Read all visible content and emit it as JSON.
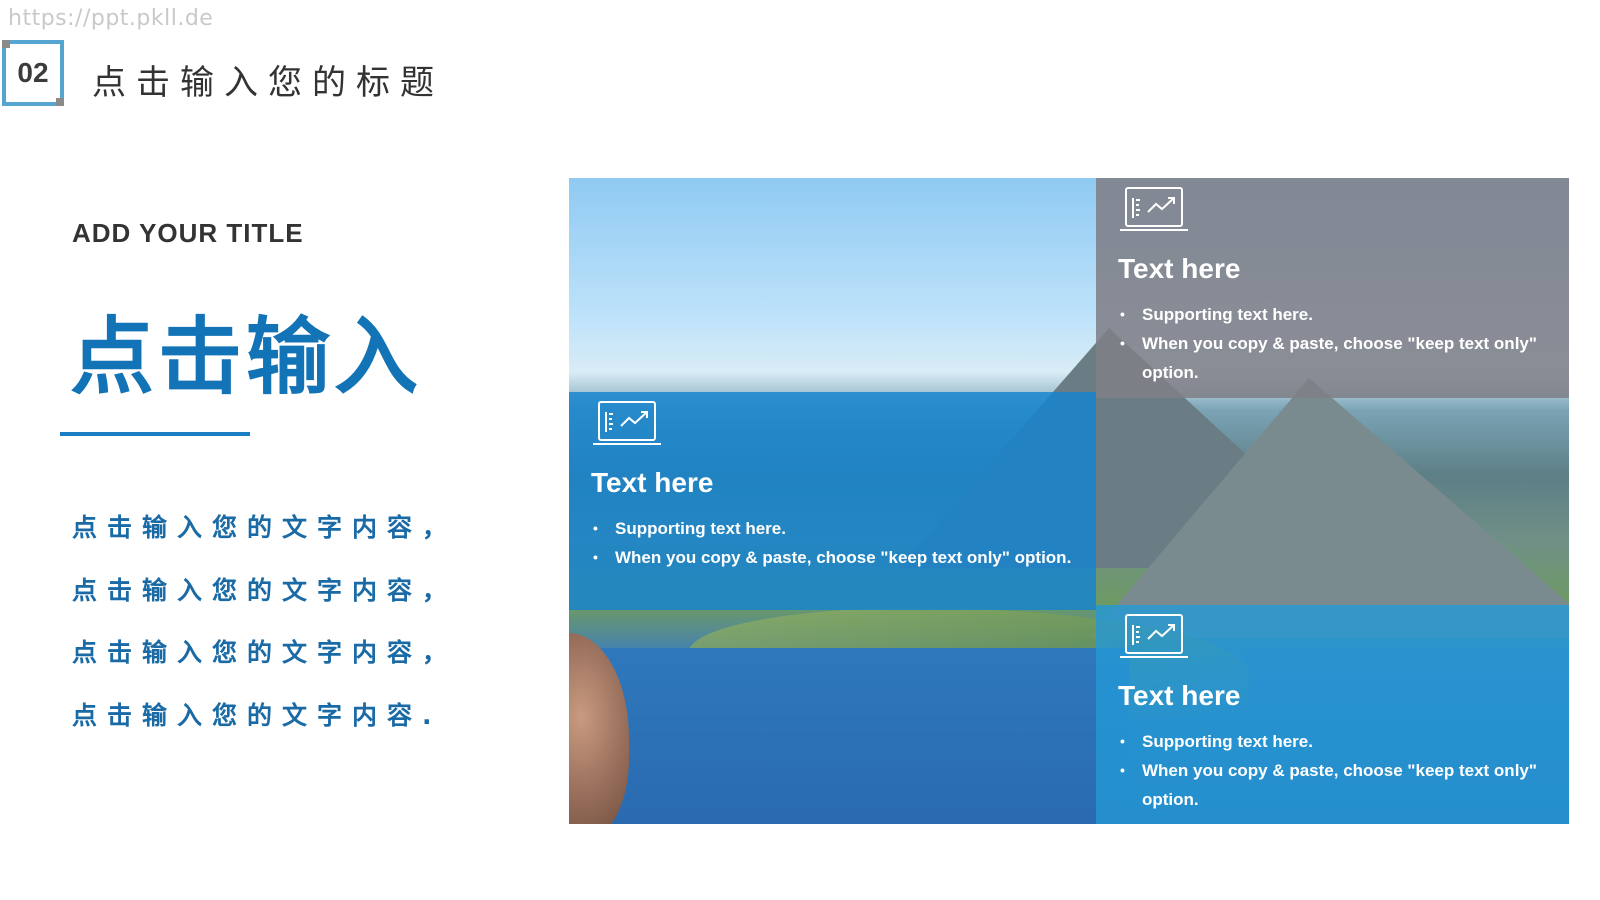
{
  "watermark": "https://ppt.pkll.de",
  "section": {
    "number": "02",
    "title": "点击输入您的标题"
  },
  "left": {
    "subtitle": "ADD YOUR TITLE",
    "big_title": "点击输入",
    "body_lines": [
      "点击输入您的文字内容，",
      "点击输入您的文字内容，",
      "点击输入您的文字内容，",
      "点击输入您的文字内容."
    ]
  },
  "panels": [
    {
      "heading": "Text here",
      "icon": "laptop-chart-icon",
      "bullets": [
        "Supporting text here.",
        "When you copy & paste, choose \"keep text only\" option."
      ]
    },
    {
      "heading": "Text here",
      "icon": "laptop-chart-icon",
      "bullets": [
        "Supporting text here.",
        "When you copy & paste, choose \"keep text only\" option."
      ]
    },
    {
      "heading": "Text here",
      "icon": "laptop-chart-icon",
      "bullets": [
        "Supporting text here.",
        "When you copy & paste, choose \"keep text only\" option."
      ]
    }
  ],
  "colors": {
    "accent_blue": "#1273b6",
    "panel_gray": "#808088",
    "panel_blue": "#1384d0",
    "section_border": "#55a5d0"
  }
}
